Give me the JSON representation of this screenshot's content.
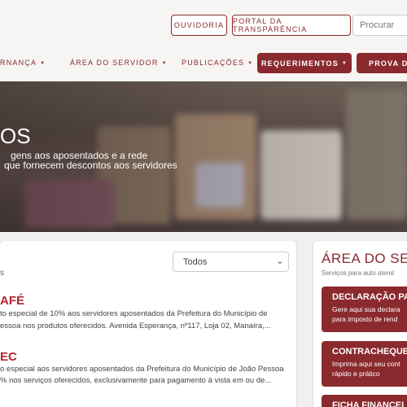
{
  "header": {
    "ouvidoria": "OUVIDORIA",
    "portal": "PORTAL DA TRANSPARÊNCIA",
    "search_placeholder": "Procurar"
  },
  "nav": {
    "items": [
      {
        "label": "RNANÇA"
      },
      {
        "label": "ÁREA DO SERVIDOR"
      },
      {
        "label": "PUBLICAÇÕES"
      }
    ],
    "requerimentos": "REQUERIMENTOS",
    "prova": "PROVA DE"
  },
  "hero": {
    "title": "OS",
    "line1": "gens aos aposentados e a rede",
    "line2": "que fornecem descontos aos servidores"
  },
  "partners": {
    "fragment": "s",
    "filter_value": "Todos",
    "items": [
      {
        "name": "AFÉ",
        "line1": "to especial de 10% aos servidores aposentados da Prefeitura do Município de",
        "line2": "essoa nos produtos oferecidos. Avenida Esperança, nº117, Loja 02, Manaíra,..."
      },
      {
        "name": "EC",
        "line1": "o especial aos servidores aposentados da Prefeitura do Município de João Pessoa",
        "line2": "% nos serviços oferecidos, exclusivamente para pagamento à vista em ou de..."
      }
    ]
  },
  "area": {
    "title": "ÁREA DO SE",
    "subtitle": "Serviços para auto atend",
    "services": [
      {
        "title": "DECLARAÇÃO PA",
        "line1": "Gere aqui sua declara",
        "line2": "para imposto de rend"
      },
      {
        "title": "CONTRACHEQUE",
        "line1": "Imprima aqui seu cont",
        "line2": "rápido e prático"
      },
      {
        "title": "FICHA FINANCEI"
      }
    ]
  },
  "colors": {
    "brand": "#8b2a2e",
    "partner_title": "#b3262b"
  }
}
